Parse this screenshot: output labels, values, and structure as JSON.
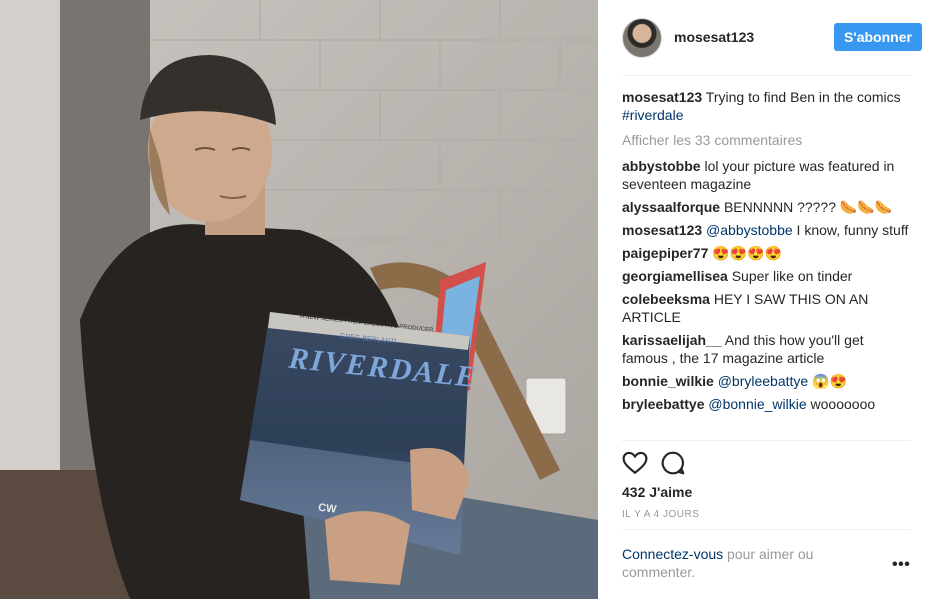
{
  "post": {
    "username": "mosesat123",
    "follow_label": "S'abonner",
    "caption": {
      "username": "mosesat123",
      "text": " Trying to find Ben in the comics ",
      "hashtag": "#riverdale"
    },
    "load_more": "Afficher les 33 commentaires",
    "comments": [
      {
        "user": "abbystobbe",
        "text": " lol your picture was featured in seventeen magazine",
        "mention": ""
      },
      {
        "user": "alyssaalforque",
        "text": " BENNNNN ????? 🌭🌭🌭",
        "mention": ""
      },
      {
        "user": "mosesat123",
        "text": " I know, funny stuff",
        "mention": " @abbystobbe"
      },
      {
        "user": "paigepiper77",
        "text": " 😍😍😍😍",
        "mention": ""
      },
      {
        "user": "georgiamellisea",
        "text": " Super like on tinder",
        "mention": ""
      },
      {
        "user": "colebeeksma",
        "text": " HEY I SAW THIS ON AN ARTICLE",
        "mention": ""
      },
      {
        "user": "karissaelijah__",
        "text": " And this how you'll get famous , the 17 magazine article",
        "mention": ""
      },
      {
        "user": "bonnie_wilkie",
        "text": " 😱😍",
        "mention": " @bryleebattye"
      },
      {
        "user": "bryleebattye",
        "text": " wooooooo",
        "mention": " @bonnie_wilkie"
      }
    ],
    "likes": "432 J'aime",
    "time": "IL Y A 4 JOURS",
    "login": {
      "link": "Connectez-vous",
      "text": " pour aimer ou commenter."
    },
    "more_label": "•••"
  },
  "photo": {
    "book_title": "RIVERDALE",
    "book_tagline": "A NEW SERIES FROM EXECUTIVE PRODUCER",
    "book_author": "GREG BERLANTI",
    "book_network": "CW"
  },
  "icons": {
    "like": "heart-icon",
    "comment": "comment-icon",
    "avatar": "avatar"
  },
  "colors": {
    "accent": "#3897f0",
    "link": "#003569",
    "muted": "#999999"
  }
}
